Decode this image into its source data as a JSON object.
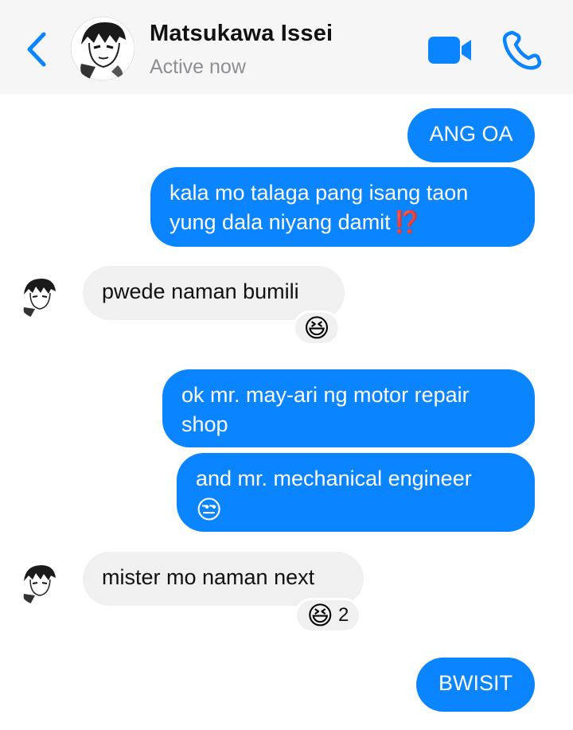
{
  "header": {
    "contact_name": "Matsukawa Issei",
    "status": "Active now",
    "icons": {
      "back": "chevron-left-icon",
      "video": "video-camera-icon",
      "phone": "phone-icon"
    },
    "accent_color": "#0a84ff"
  },
  "messages": [
    {
      "direction": "outgoing",
      "text": "ANG OA"
    },
    {
      "direction": "outgoing",
      "line1": "kala mo talaga pang isang taon",
      "line2": "yung dala niyang damit",
      "emoji": "⁉️"
    },
    {
      "direction": "incoming",
      "text": "pwede naman bumili",
      "reaction": {
        "emoji": "😆"
      }
    },
    {
      "direction": "outgoing",
      "line1": "ok mr. may-ari ng motor repair",
      "line2": "shop"
    },
    {
      "direction": "outgoing",
      "line1": "and mr. mechanical engineer",
      "emoji": "😒"
    },
    {
      "direction": "incoming",
      "text": "mister mo naman next",
      "reaction": {
        "emoji": "😆",
        "count": "2"
      }
    },
    {
      "direction": "outgoing",
      "text": "BWISIT"
    }
  ],
  "colors": {
    "outgoing_bubble": "#0a84ff",
    "incoming_bubble": "#f0f0f0",
    "header_bg": "#f6f6f6"
  }
}
